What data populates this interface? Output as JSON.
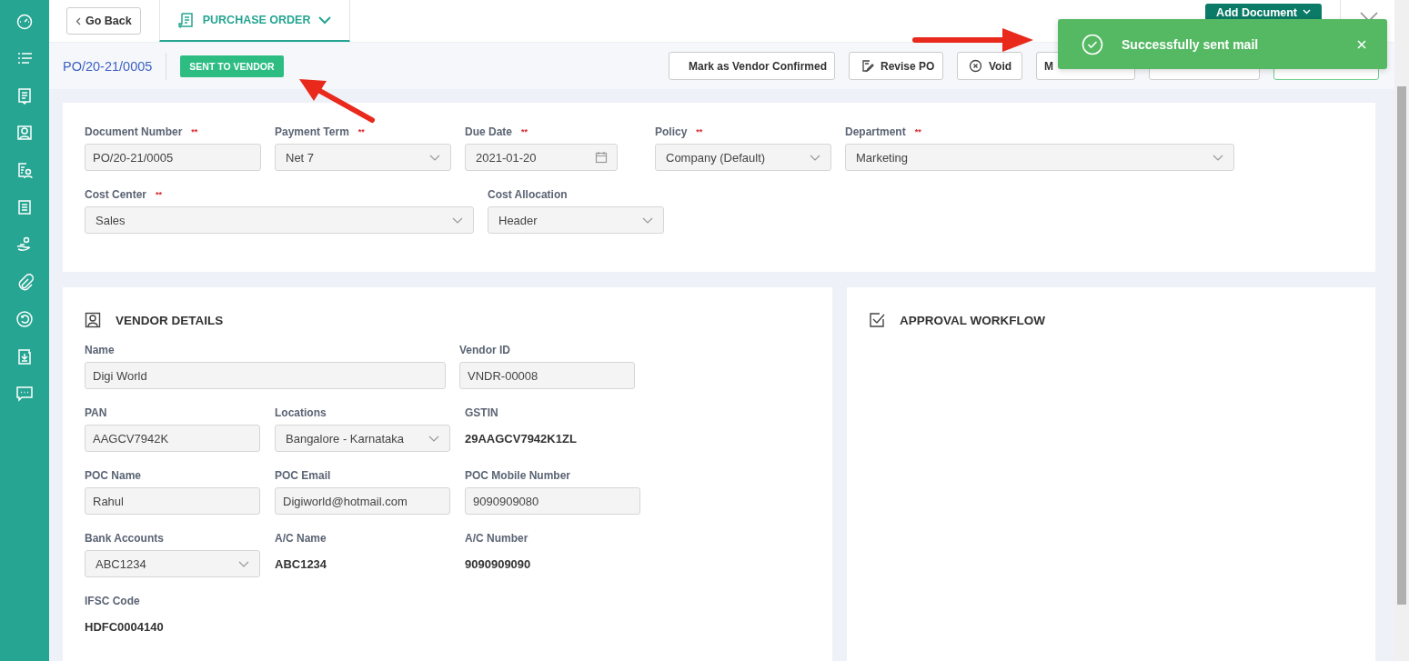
{
  "sidebar": {
    "items": [
      {
        "kind": "gauge",
        "selected": false
      },
      {
        "kind": "list",
        "selected": false
      },
      {
        "kind": "doc",
        "selected": false
      },
      {
        "kind": "contact",
        "selected": false
      },
      {
        "kind": "people-doc",
        "selected": false
      },
      {
        "kind": "form",
        "selected": false
      },
      {
        "kind": "hand",
        "selected": false
      },
      {
        "kind": "clip",
        "selected": false
      },
      {
        "kind": "cycle",
        "selected": false
      },
      {
        "kind": "download",
        "selected": false
      },
      {
        "kind": "chat",
        "selected": false
      }
    ]
  },
  "top_bar": {
    "back_button": "Go Back",
    "tab": {
      "label": "PURCHASE ORDER",
      "selected": true
    },
    "add_button": "Add Document"
  },
  "header": {
    "document_number": "PO/20-21/0005",
    "status": "SENT TO VENDOR",
    "actions": [
      {
        "kind": "plain",
        "label": "Mark as Vendor Confirmed"
      },
      {
        "kind": "revise",
        "label": "Revise PO"
      },
      {
        "kind": "void",
        "label": "Void"
      },
      {
        "kind": "plain",
        "label": "M"
      },
      {
        "kind": "covered"
      },
      {
        "kind": "success"
      }
    ]
  },
  "toast": {
    "message": "Successfully sent mail"
  },
  "form": {
    "fields": [
      {
        "label": "Document Number",
        "required_mark": "**",
        "kind": "input",
        "value": "PO/20-21/0005"
      },
      {
        "label": "Payment Term",
        "required_mark": "**",
        "kind": "select",
        "value": "Net 7"
      },
      {
        "label": "Due Date",
        "required_mark": "**",
        "kind": "date",
        "value": "2021-01-20"
      },
      {
        "label": "Policy",
        "required_mark": "**",
        "kind": "select",
        "value": "Company (Default)"
      },
      {
        "label": "Department",
        "required_mark": "**",
        "kind": "select",
        "value": "Marketing"
      },
      {
        "label": "Cost Center",
        "required_mark": "**",
        "kind": "select",
        "value": "Sales"
      },
      {
        "label": "Cost Allocation",
        "kind": "select",
        "value": "Header"
      }
    ]
  },
  "vendor_details": {
    "title": "VENDOR DETAILS",
    "fields": [
      {
        "label": "Name",
        "kind": "input",
        "value": "Digi World"
      },
      {
        "label": "Vendor ID",
        "kind": "input",
        "value": "VNDR-00008"
      },
      {
        "label": "PAN",
        "kind": "input",
        "value": "AAGCV7942K"
      },
      {
        "label": "Locations",
        "kind": "select",
        "value": "Bangalore - Karnataka"
      },
      {
        "label": "GSTIN",
        "kind": "static",
        "value": "29AAGCV7942K1ZL"
      },
      {
        "label": "POC Name",
        "kind": "input",
        "value": "Rahul"
      },
      {
        "label": "POC Email",
        "kind": "input",
        "value": "Digiworld@hotmail.com"
      },
      {
        "label": "POC Mobile Number",
        "kind": "input",
        "value": "9090909080"
      },
      {
        "label": "Bank Accounts",
        "kind": "select",
        "value": "ABC1234"
      },
      {
        "label": "A/C Name",
        "kind": "static",
        "value": "ABC1234"
      },
      {
        "label": "A/C Number",
        "kind": "static",
        "value": "9090909090"
      },
      {
        "label": "IFSC Code",
        "kind": "static",
        "value": "HDFC0004140"
      }
    ]
  },
  "approval_workflow": {
    "title": "APPROVAL WORKFLOW"
  }
}
